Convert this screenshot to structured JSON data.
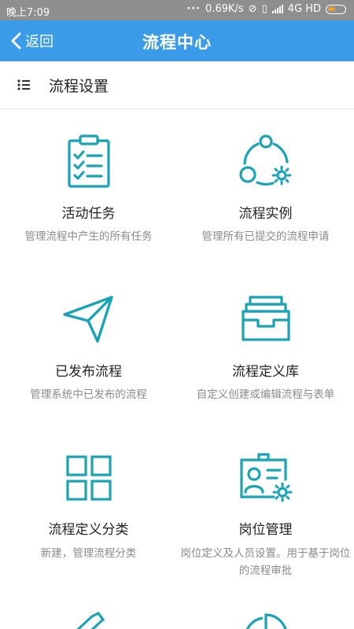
{
  "status_bar": {
    "time": "晚上7:09",
    "speed": "0.69K/s",
    "network": "4G HD"
  },
  "nav": {
    "back_label": "返回",
    "title": "流程中心"
  },
  "section": {
    "title": "流程设置"
  },
  "colors": {
    "accent": "#3a9be9",
    "icon": "#1aa3b4"
  },
  "items": [
    {
      "label": "活动任务",
      "desc": "管理流程中产生的所有任务",
      "icon": "clipboard-list-icon"
    },
    {
      "label": "流程实例",
      "desc": "管理所有已提交的流程申请",
      "icon": "process-cycle-gear-icon"
    },
    {
      "label": "已发布流程",
      "desc": "管理系统中已发布的流程",
      "icon": "paper-plane-icon"
    },
    {
      "label": "流程定义库",
      "desc": "自定义创建或编辑流程与表单",
      "icon": "archive-box-icon"
    },
    {
      "label": "流程定义分类",
      "desc": "新建，管理流程分类",
      "icon": "grid-category-icon"
    },
    {
      "label": "岗位管理",
      "desc": "岗位定义及人员设置。用于基于岗位的流程审批",
      "icon": "id-card-gear-icon"
    }
  ]
}
